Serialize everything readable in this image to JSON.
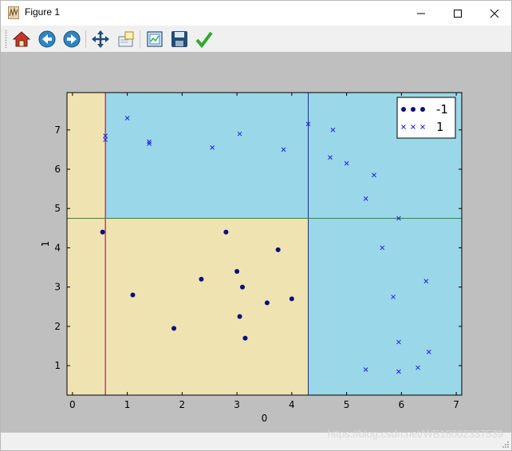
{
  "window": {
    "title": "Figure 1"
  },
  "toolbar": {
    "buttons": [
      {
        "name": "home-icon"
      },
      {
        "name": "back-icon"
      },
      {
        "name": "forward-icon"
      },
      {
        "name": "pan-icon"
      },
      {
        "name": "zoom-icon"
      },
      {
        "name": "subplots-icon"
      },
      {
        "name": "save-icon"
      },
      {
        "name": "edit-axis-icon"
      }
    ]
  },
  "status": {
    "watermark": "https://blog.csdn.net/WB18002337539"
  },
  "chart_data": {
    "type": "scatter",
    "xlabel": "0",
    "ylabel": "1",
    "xlim": [
      -0.1,
      7.1
    ],
    "ylim": [
      0.25,
      7.95
    ],
    "xticks": [
      "0",
      "1",
      "2",
      "3",
      "4",
      "5",
      "6",
      "7"
    ],
    "yticks": [
      "1",
      "2",
      "3",
      "4",
      "5",
      "6",
      "7"
    ],
    "grid": false,
    "legend_position": "upper right",
    "colors": {
      "region_neg": "#efe3b1",
      "region_pos": "#9ad7e8",
      "series_neg": "#0d0d80",
      "series_pos": "#2020e8",
      "figure_bg": "#bfbfbf",
      "split_vertical_left": "#8b0c3a",
      "split_vertical_right": "#2424aa",
      "split_horizontal": "#2e8b2e"
    },
    "decision_regions": [
      {
        "x": [
          -0.1,
          0.6
        ],
        "y": [
          0.25,
          7.95
        ],
        "label": -1
      },
      {
        "x": [
          0.6,
          4.3
        ],
        "y": [
          0.25,
          4.75
        ],
        "label": -1
      },
      {
        "x": [
          0.6,
          4.3
        ],
        "y": [
          4.75,
          7.95
        ],
        "label": 1
      },
      {
        "x": [
          4.3,
          7.1
        ],
        "y": [
          0.25,
          7.95
        ],
        "label": 1
      }
    ],
    "split_lines": [
      {
        "orient": "v",
        "value": 0.6
      },
      {
        "orient": "v",
        "value": 4.3
      },
      {
        "orient": "h",
        "value": 4.75
      }
    ],
    "series": [
      {
        "name": "-1",
        "marker": "circle",
        "points": [
          [
            0.55,
            4.4
          ],
          [
            1.1,
            2.8
          ],
          [
            1.85,
            1.95
          ],
          [
            2.35,
            3.2
          ],
          [
            2.8,
            4.4
          ],
          [
            3.0,
            3.4
          ],
          [
            3.05,
            2.25
          ],
          [
            3.1,
            3.0
          ],
          [
            3.15,
            1.7
          ],
          [
            3.55,
            2.6
          ],
          [
            3.75,
            3.95
          ],
          [
            4.0,
            2.7
          ]
        ]
      },
      {
        "name": "1",
        "marker": "x",
        "points": [
          [
            0.6,
            6.85
          ],
          [
            0.6,
            6.75
          ],
          [
            1.0,
            7.3
          ],
          [
            1.4,
            6.7
          ],
          [
            1.4,
            6.65
          ],
          [
            2.55,
            6.55
          ],
          [
            3.05,
            6.9
          ],
          [
            3.85,
            6.5
          ],
          [
            4.3,
            7.15
          ],
          [
            4.75,
            7.0
          ],
          [
            4.7,
            6.3
          ],
          [
            5.0,
            6.15
          ],
          [
            5.5,
            5.85
          ],
          [
            5.35,
            5.25
          ],
          [
            5.95,
            4.75
          ],
          [
            5.65,
            4.0
          ],
          [
            6.45,
            3.15
          ],
          [
            5.85,
            2.75
          ],
          [
            5.95,
            1.6
          ],
          [
            6.5,
            1.35
          ],
          [
            5.35,
            0.9
          ],
          [
            5.95,
            0.85
          ],
          [
            6.3,
            0.95
          ]
        ]
      }
    ]
  }
}
